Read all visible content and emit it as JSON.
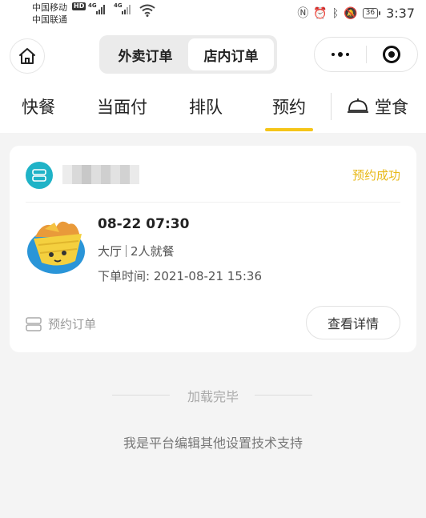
{
  "status_bar": {
    "carrier1": "中国移动",
    "carrier2": "中国联通",
    "hd": "HD",
    "net1": "4G",
    "net2": "4G",
    "battery": "36",
    "time": "3:37"
  },
  "header": {
    "home_icon": "home-icon",
    "segments": [
      "外卖订单",
      "店内订单"
    ],
    "active_segment": "店内订单",
    "more_icon": "more-dots-icon",
    "close_icon": "miniprogram-close-icon"
  },
  "tabs": {
    "items": [
      "快餐",
      "当面付",
      "排队",
      "预约"
    ],
    "active": "预约",
    "dine_in": "堂食",
    "dine_in_icon": "cloche-icon",
    "accent_color": "#f5c518"
  },
  "order": {
    "status": "预约成功",
    "status_color": "#e8b91a",
    "date": "08-22 07:30",
    "hall": "大厅",
    "people": "2人就餐",
    "order_time_label": "下单时间:",
    "order_time": "2021-08-21 15:36",
    "order_type": "预约订单",
    "detail_button": "查看详情"
  },
  "footer": {
    "loaded": "加载完毕",
    "support": "我是平台编辑其他设置技术支持"
  }
}
